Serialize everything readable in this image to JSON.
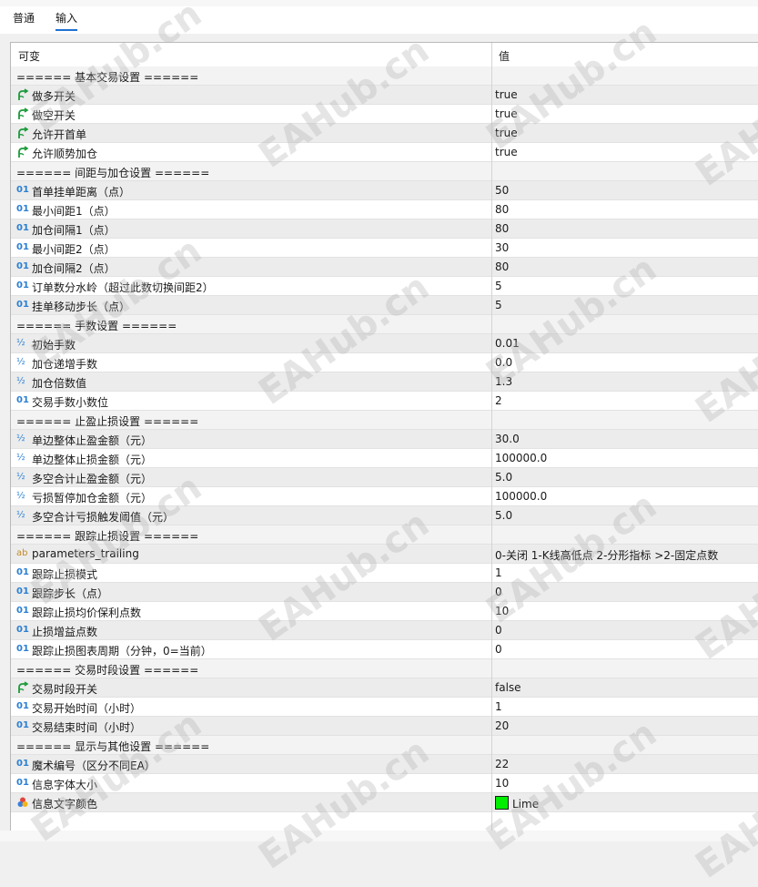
{
  "tabs": [
    {
      "label": "普通"
    },
    {
      "label": "输入"
    }
  ],
  "active_tab": 1,
  "header": {
    "col1": "可变",
    "col2": "值"
  },
  "watermark": "EAHub.cn",
  "color_value": "#00ee00",
  "rows": [
    {
      "type": "sep",
      "name": "====== 基本交易设置 ======",
      "value": ""
    },
    {
      "type": "bool",
      "name": "做多开关",
      "value": "true"
    },
    {
      "type": "bool",
      "name": "做空开关",
      "value": "true"
    },
    {
      "type": "bool",
      "name": "允许开首单",
      "value": "true"
    },
    {
      "type": "bool",
      "name": "允许顺势加仓",
      "value": "true"
    },
    {
      "type": "sep",
      "name": "====== 间距与加仓设置 ======",
      "value": ""
    },
    {
      "type": "int",
      "name": "首单挂单距离（点）",
      "value": "50"
    },
    {
      "type": "int",
      "name": "最小间距1（点）",
      "value": "80"
    },
    {
      "type": "int",
      "name": "加仓间隔1（点）",
      "value": "80"
    },
    {
      "type": "int",
      "name": "最小间距2（点）",
      "value": "30"
    },
    {
      "type": "int",
      "name": "加仓间隔2（点）",
      "value": "80"
    },
    {
      "type": "int",
      "name": "订单数分水岭（超过此数切换间距2）",
      "value": "5"
    },
    {
      "type": "int",
      "name": "挂单移动步长（点）",
      "value": "5"
    },
    {
      "type": "sep",
      "name": "====== 手数设置 ======",
      "value": ""
    },
    {
      "type": "double",
      "name": "初始手数",
      "value": "0.01"
    },
    {
      "type": "double",
      "name": "加仓递增手数",
      "value": "0.0"
    },
    {
      "type": "double",
      "name": "加仓倍数值",
      "value": "1.3"
    },
    {
      "type": "int",
      "name": "交易手数小数位",
      "value": "2"
    },
    {
      "type": "sep",
      "name": "====== 止盈止损设置 ======",
      "value": ""
    },
    {
      "type": "double",
      "name": "单边整体止盈金额（元）",
      "value": "30.0"
    },
    {
      "type": "double",
      "name": "单边整体止损金额（元）",
      "value": "100000.0"
    },
    {
      "type": "double",
      "name": "多空合计止盈金额（元）",
      "value": "5.0"
    },
    {
      "type": "double",
      "name": "亏损暂停加仓金额（元）",
      "value": "100000.0"
    },
    {
      "type": "double",
      "name": "多空合计亏损触发阈值（元）",
      "value": "5.0"
    },
    {
      "type": "sep",
      "name": "====== 跟踪止损设置 ======",
      "value": ""
    },
    {
      "type": "string",
      "name": "parameters_trailing",
      "value": "0-关闭  1-K线高低点  2-分形指标  >2-固定点数"
    },
    {
      "type": "int",
      "name": "跟踪止损模式",
      "value": "1"
    },
    {
      "type": "int",
      "name": "跟踪步长（点）",
      "value": "0"
    },
    {
      "type": "int",
      "name": "跟踪止损均价保利点数",
      "value": "10"
    },
    {
      "type": "int",
      "name": "止损增益点数",
      "value": "0"
    },
    {
      "type": "int",
      "name": "跟踪止损图表周期（分钟，0=当前）",
      "value": "0"
    },
    {
      "type": "sep",
      "name": "====== 交易时段设置 ======",
      "value": ""
    },
    {
      "type": "bool",
      "name": "交易时段开关",
      "value": "false"
    },
    {
      "type": "int",
      "name": "交易开始时间（小时）",
      "value": "1"
    },
    {
      "type": "int",
      "name": "交易结束时间（小时）",
      "value": "20"
    },
    {
      "type": "sep",
      "name": "====== 显示与其他设置 ======",
      "value": ""
    },
    {
      "type": "int",
      "name": "魔术编号（区分不同EA）",
      "value": "22"
    },
    {
      "type": "int",
      "name": "信息字体大小",
      "value": "10"
    },
    {
      "type": "color",
      "name": "信息文字颜色",
      "value": "Lime"
    }
  ]
}
